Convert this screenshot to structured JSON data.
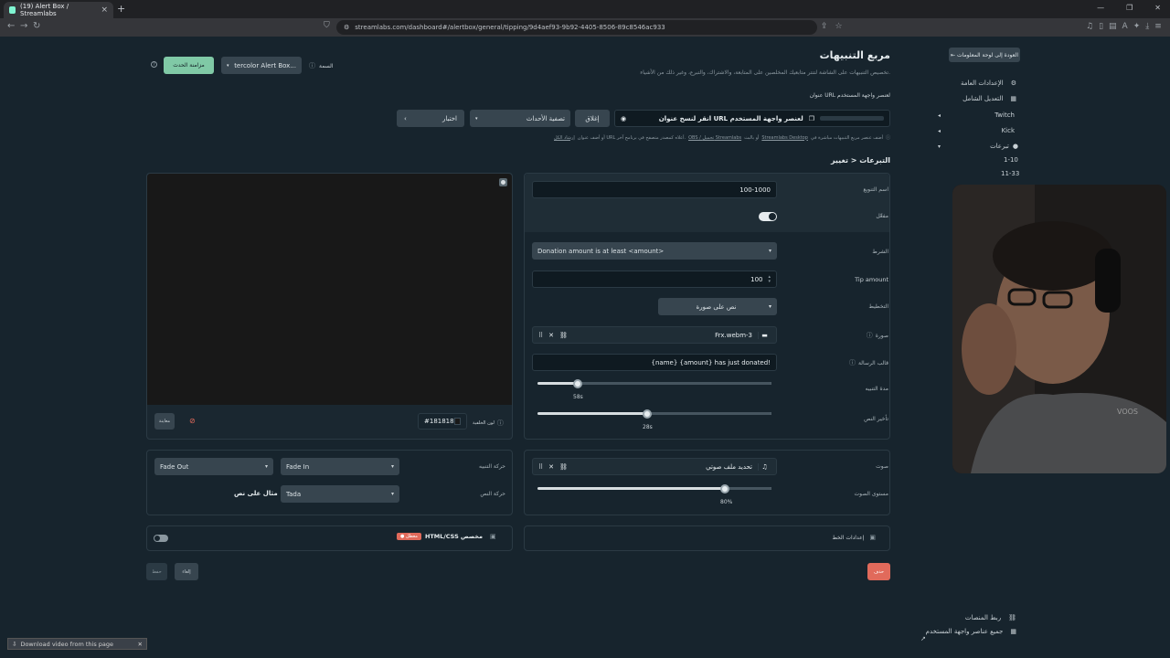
{
  "browser": {
    "tab_title": "(19) Alert Box / Streamlabs",
    "url": "streamlabs.com/dashboard#/alertbox/general/tipping/9d4aef93-9b92-4405-8506-89c8546ac933"
  },
  "page": {
    "title": "مربع التنبيهات",
    "description": "تخصيص التنبيهات على الشاشة لتنتر متابعيك المخلصين على المتابعة، والاشتراك، والتبرع، وغير ذلك من الأشياء.",
    "url_label": "عنوان URL لعنصر واجهة المستخدم",
    "url_placeholder": "انقر لنسخ عنوان URL لعنصر واجهة المستخدم",
    "copy_label": "إغلاق",
    "filter_label": "تصفية الأحداث",
    "test_label": "اختبار",
    "theme_label": "السمة",
    "theme_value": "tercolor Alert Box...",
    "sync_label": "مزامنة الحدث",
    "info_note_a": "أضف عنصر مربع التنبيهات مباشرة في",
    "info_link_desktop": "Streamlabs Desktop",
    "info_note_b": "أو بالبث",
    "info_link_obs": "OBS / تحميل Streamlabs",
    "info_note_c": "أو أضف عنوان URL أعلاه كمصدر متصفح في برنامج آخر.",
    "info_link_more": "إرشاد الكل"
  },
  "breadcrumb": "التبرعات < تغيير",
  "form": {
    "variation_name_label": "اسم التنويع",
    "variation_name_value": "100-1000",
    "enabled_label": "مفعّل",
    "condition_label": "الشرط",
    "condition_value": "Donation amount is at least <amount>",
    "tip_amount_label": "Tip amount",
    "tip_amount_value": "100",
    "layout_label": "التخطيط",
    "layout_value": "نص على صورة",
    "image_label": "صورة",
    "image_file": "Frx.webm-3",
    "message_template_label": "قالب الرسالة",
    "message_template_value": "{name} {amount} has just donated!",
    "alert_duration_label": "مدة التنبيه",
    "alert_duration_value": "58s",
    "alert_duration_fraction": 0.17,
    "text_delay_label": "تأخير النص",
    "text_delay_value": "28s",
    "text_delay_fraction": 0.47,
    "sound_label": "صوت",
    "sound_file": "تحديد ملف صوتي",
    "sound_volume_label": "مستوى الصوت",
    "sound_volume_value": "80%",
    "sound_volume_fraction": 0.8,
    "font_settings_label": "إعدادات الخط"
  },
  "preview": {
    "bg_color_label": "لون الخلفية",
    "bg_color_value": "#181818",
    "preview_button": "معاينة"
  },
  "animation": {
    "alert_anim_label": "حركة التنبيه",
    "alert_in_value": "Fade In",
    "alert_out_value": "Fade Out",
    "text_anim_label": "حركة النص",
    "text_anim_value": "Tada",
    "text_preview": "مثال على نص"
  },
  "custom_html": {
    "label": "HTML/CSS مخصص",
    "badge": "معطل"
  },
  "actions": {
    "delete": "حذف",
    "cancel": "إلغاء",
    "save": "حفظ"
  },
  "sidebar": {
    "back": "العودة إلى لوحة المعلومات",
    "items": [
      {
        "label": "الإعدادات العامة"
      },
      {
        "label": "التعديل الشامل"
      },
      {
        "label": "Twitch"
      },
      {
        "label": "Kick"
      },
      {
        "label": "تبرعات"
      },
      {
        "label": "1-10"
      },
      {
        "label": "11-33"
      }
    ],
    "bottom_link_1": "ربط المنصات",
    "bottom_link_2": "جميع عناصر واجهة المستخدم"
  },
  "overlay": {
    "download_text": "Download video from this page",
    "webcam_shirt_text": "VOOS"
  },
  "colors": {
    "accent": "#80f5d2",
    "danger": "#e16a5b",
    "bg": "#17242d"
  }
}
